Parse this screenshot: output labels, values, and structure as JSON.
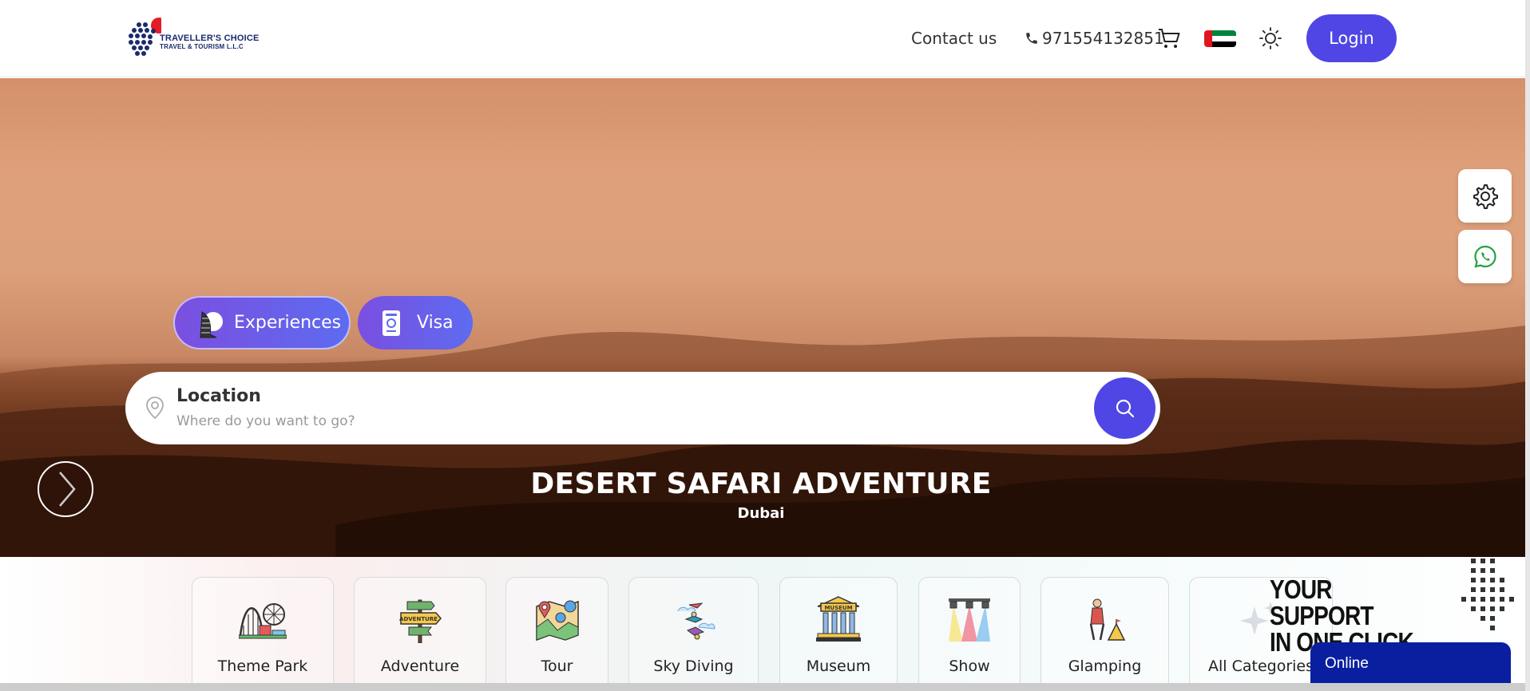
{
  "header": {
    "logo": {
      "line1_a": "TRAVELLER'S ",
      "line1_b": "CHOICE",
      "line2": "TRAVEL & TOURISM L.L.C"
    },
    "contact_label": "Contact us",
    "phone": "971554132851",
    "login_label": "Login",
    "icons": [
      "phone-icon",
      "cart-icon",
      "uae-flag-icon",
      "sun-icon"
    ]
  },
  "hero": {
    "tabs": [
      {
        "label": "Experiences",
        "icon": "burj-al-arab-icon"
      },
      {
        "label": "Visa",
        "icon": "passport-icon"
      }
    ],
    "search": {
      "label": "Location",
      "placeholder": "Where do you want to go?"
    },
    "slide_title": "DESERT SAFARI ADVENTURE",
    "slide_subtitle": "Dubai"
  },
  "side_buttons": [
    "gear-icon",
    "whatsapp-icon"
  ],
  "categories": [
    {
      "label": "Theme Park",
      "icon": "roller-coaster-icon"
    },
    {
      "label": "Adventure",
      "icon": "signpost-icon"
    },
    {
      "label": "Tour",
      "icon": "map-icon"
    },
    {
      "label": "Sky Diving",
      "icon": "skydiver-icon"
    },
    {
      "label": "Museum",
      "icon": "museum-icon"
    },
    {
      "label": "Show",
      "icon": "spotlight-icon"
    },
    {
      "label": "Glamping",
      "icon": "camping-icon"
    },
    {
      "label": "All Categories",
      "icon": "sparkle-icon"
    }
  ],
  "support": {
    "line1": "YOUR SUPPORT",
    "line2": "IN ONE CLICK",
    "online_label": "Online"
  },
  "colors": {
    "primary": "#4f46e5",
    "online": "#0a1fa0",
    "logo_red": "#c8102e",
    "logo_navy": "#1a2a6c"
  }
}
